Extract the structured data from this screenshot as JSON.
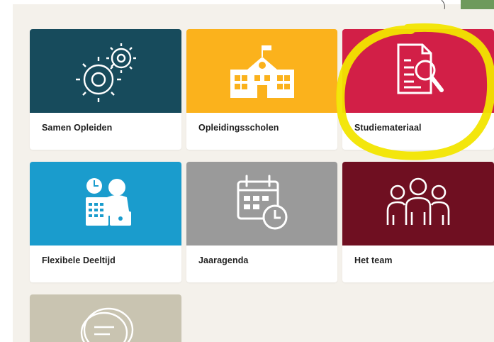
{
  "colors": {
    "panel_bg": "#f4f1eb",
    "samen_opleiden": "#174b5c",
    "opleidingsscholen": "#fbb21c",
    "studiemateriaal": "#d21f47",
    "flexibele_deeltijd": "#1a9ccd",
    "jaaragenda": "#9a9a9a",
    "het_team": "#6f0f21",
    "partial_tile": "#c9c4b1",
    "highlight": "#f2e500"
  },
  "tiles": [
    {
      "label": "Samen Opleiden",
      "icon": "gears-icon"
    },
    {
      "label": "Opleidingsscholen",
      "icon": "school-building-icon"
    },
    {
      "label": "Studiemateriaal",
      "icon": "document-search-icon"
    },
    {
      "label": "Flexibele Deeltijd",
      "icon": "teacher-calendar-icon"
    },
    {
      "label": "Jaaragenda",
      "icon": "calendar-clock-icon"
    },
    {
      "label": "Het team",
      "icon": "team-people-icon"
    },
    {
      "label": "",
      "icon": "chat-bubbles-icon"
    }
  ]
}
